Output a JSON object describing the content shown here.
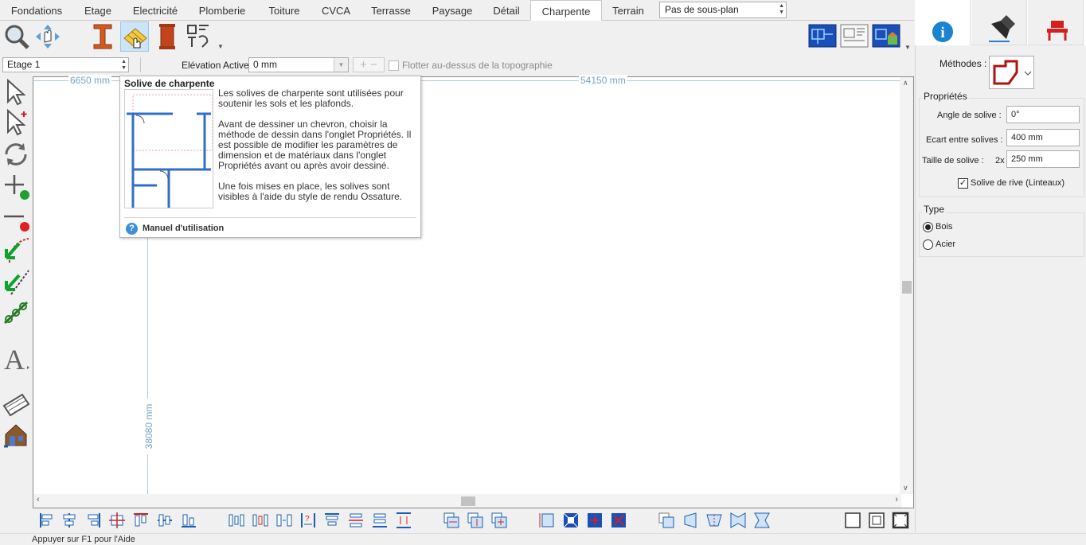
{
  "tabs": [
    {
      "label": "Fondations"
    },
    {
      "label": "Etage"
    },
    {
      "label": "Electricité"
    },
    {
      "label": "Plomberie"
    },
    {
      "label": "Toiture"
    },
    {
      "label": "CVCA"
    },
    {
      "label": "Terrasse"
    },
    {
      "label": "Paysage"
    },
    {
      "label": "Détail"
    },
    {
      "label": "Charpente"
    },
    {
      "label": "Terrain"
    }
  ],
  "active_tab": "Charpente",
  "subplan": {
    "value": "Pas de sous-plan"
  },
  "levelbar": {
    "level": "Etage 1",
    "elevation_label": "Elévation Active:",
    "elevation_value": "0 mm",
    "float_label": "Flotter au-dessus de la topographie"
  },
  "canvas": {
    "dim_top_left": "6650 mm",
    "dim_top_right": "54150 mm",
    "dim_vertical": "38080 mm"
  },
  "tooltip": {
    "title": "Solive de charpente",
    "p1": "Les solives de charpente sont utilisées pour soutenir les sols et les plafonds.",
    "p2": "Avant de dessiner un chevron, choisir la méthode de dessin dans l'onglet Propriétés. Il est possible de modifier les paramètres de dimension et de matériaux dans l'onglet Propriétés avant ou après avoir dessiné.",
    "p3": "Une fois mises en place, les solives sont visibles à l'aide du style de rendu Ossature.",
    "help_link": "Manuel d'utilisation"
  },
  "status": {
    "text": "Appuyer sur F1 pour l'Aide"
  },
  "properties": {
    "methods_label": "Méthodes :",
    "group_title": "Propriétés",
    "angle_label": "Angle de solive :",
    "angle_value": "0°",
    "spacing_label": "Ecart entre solives :",
    "spacing_value": "400 mm",
    "size_label": "Taille de solive :",
    "size_prefix": "2x",
    "size_value": "250 mm",
    "rim_label": "Solive de rive (Linteaux)",
    "rim_checked": true
  },
  "type": {
    "group_title": "Type",
    "options": [
      {
        "label": "Bois",
        "selected": true
      },
      {
        "label": "Acier",
        "selected": false
      }
    ]
  },
  "colors": {
    "accent": "#1a82d0",
    "selected_bg": "#cde4f7",
    "dimension": "#7aa3c2"
  }
}
